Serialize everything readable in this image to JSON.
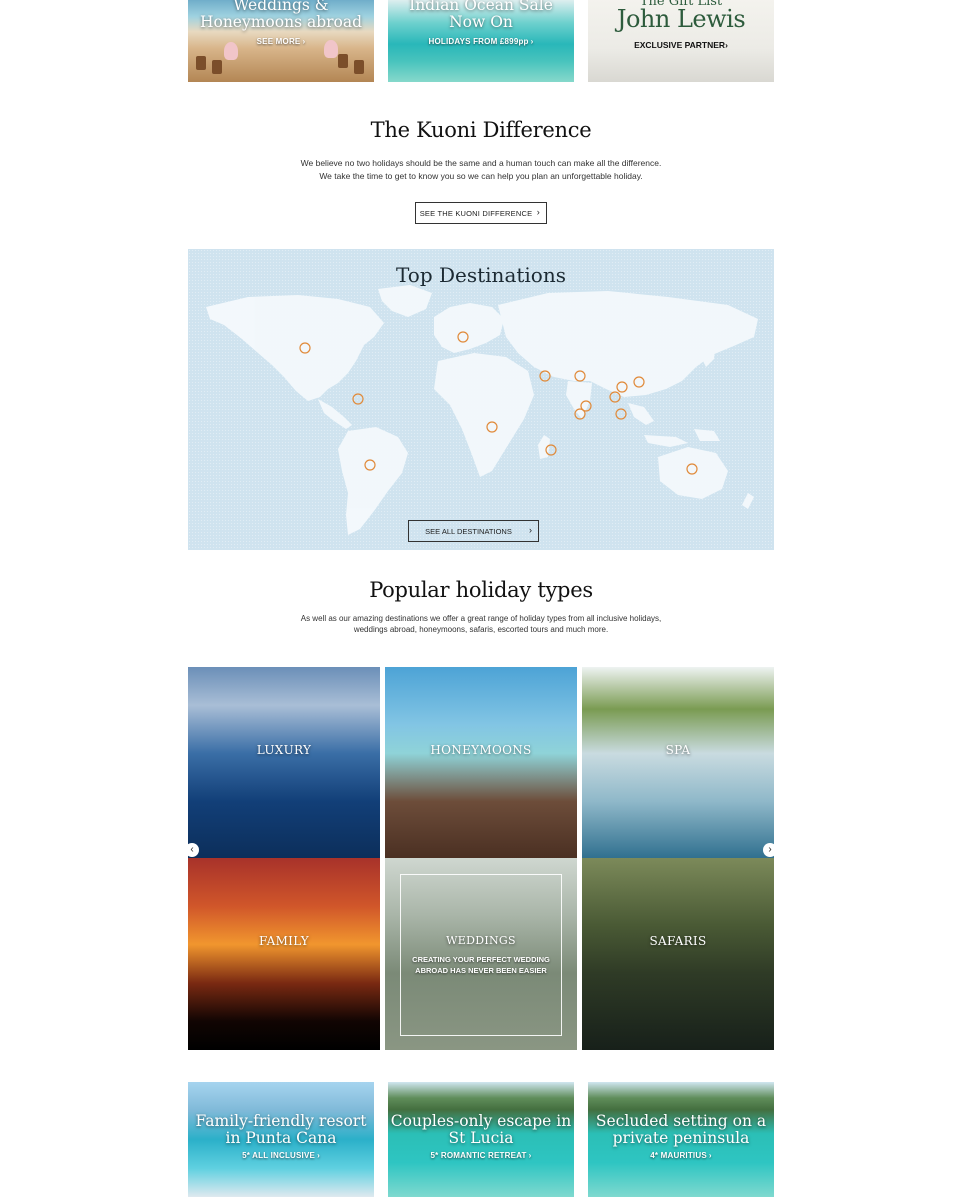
{
  "top_promos": [
    {
      "title_line1": "Weddings &",
      "title_line2": "Honeymoons abroad",
      "cta": "SEE MORE"
    },
    {
      "title_line1": "Indian Ocean Sale",
      "title_line2": "Now On",
      "cta": "HOLIDAYS FROM £899pp"
    },
    {
      "title_line1": "The Gift List",
      "brand": "John Lewis",
      "cta": "EXCLUSIVE PARTNER"
    }
  ],
  "difference": {
    "heading": "The Kuoni Difference",
    "line1": "We believe no two holidays should be the same and a human touch can make all the difference.",
    "line2": "We take the time to get to know you so we can help you plan an unforgettable holiday.",
    "button": "SEE THE KUONI DIFFERENCE"
  },
  "destinations": {
    "heading": "Top Destinations",
    "button": "SEE ALL DESTINATIONS",
    "marker_color": "#e08a3a"
  },
  "holiday_types": {
    "heading": "Popular holiday types",
    "line1": "As well as our amazing destinations we offer a great range of holiday types from all inclusive holidays,",
    "line2": "weddings abroad, honeymoons, safaris, escorted tours and much more.",
    "tiles": [
      {
        "label": "LUXURY"
      },
      {
        "label": "HONEYMOONS"
      },
      {
        "label": "SPA"
      },
      {
        "label": "FAMILY"
      },
      {
        "label": "WEDDINGS",
        "subtitle_line1": "CREATING YOUR PERFECT WEDDING",
        "subtitle_line2": "ABROAD HAS NEVER BEEN EASIER"
      },
      {
        "label": "SAFARIS"
      }
    ]
  },
  "bottom_promos": [
    {
      "title_line1": "Family-friendly resort",
      "title_line2": "in Punta Cana",
      "cta": "5* ALL INCLUSIVE"
    },
    {
      "title_line1": "Couples-only escape in",
      "title_line2": "St Lucia",
      "cta": "5* ROMANTIC RETREAT"
    },
    {
      "title_line1": "Secluded setting on a",
      "title_line2": "private peninsula",
      "cta": "4* MAURITIUS"
    }
  ],
  "icons": {
    "chevron": "›",
    "prev": "‹",
    "next": "›"
  }
}
